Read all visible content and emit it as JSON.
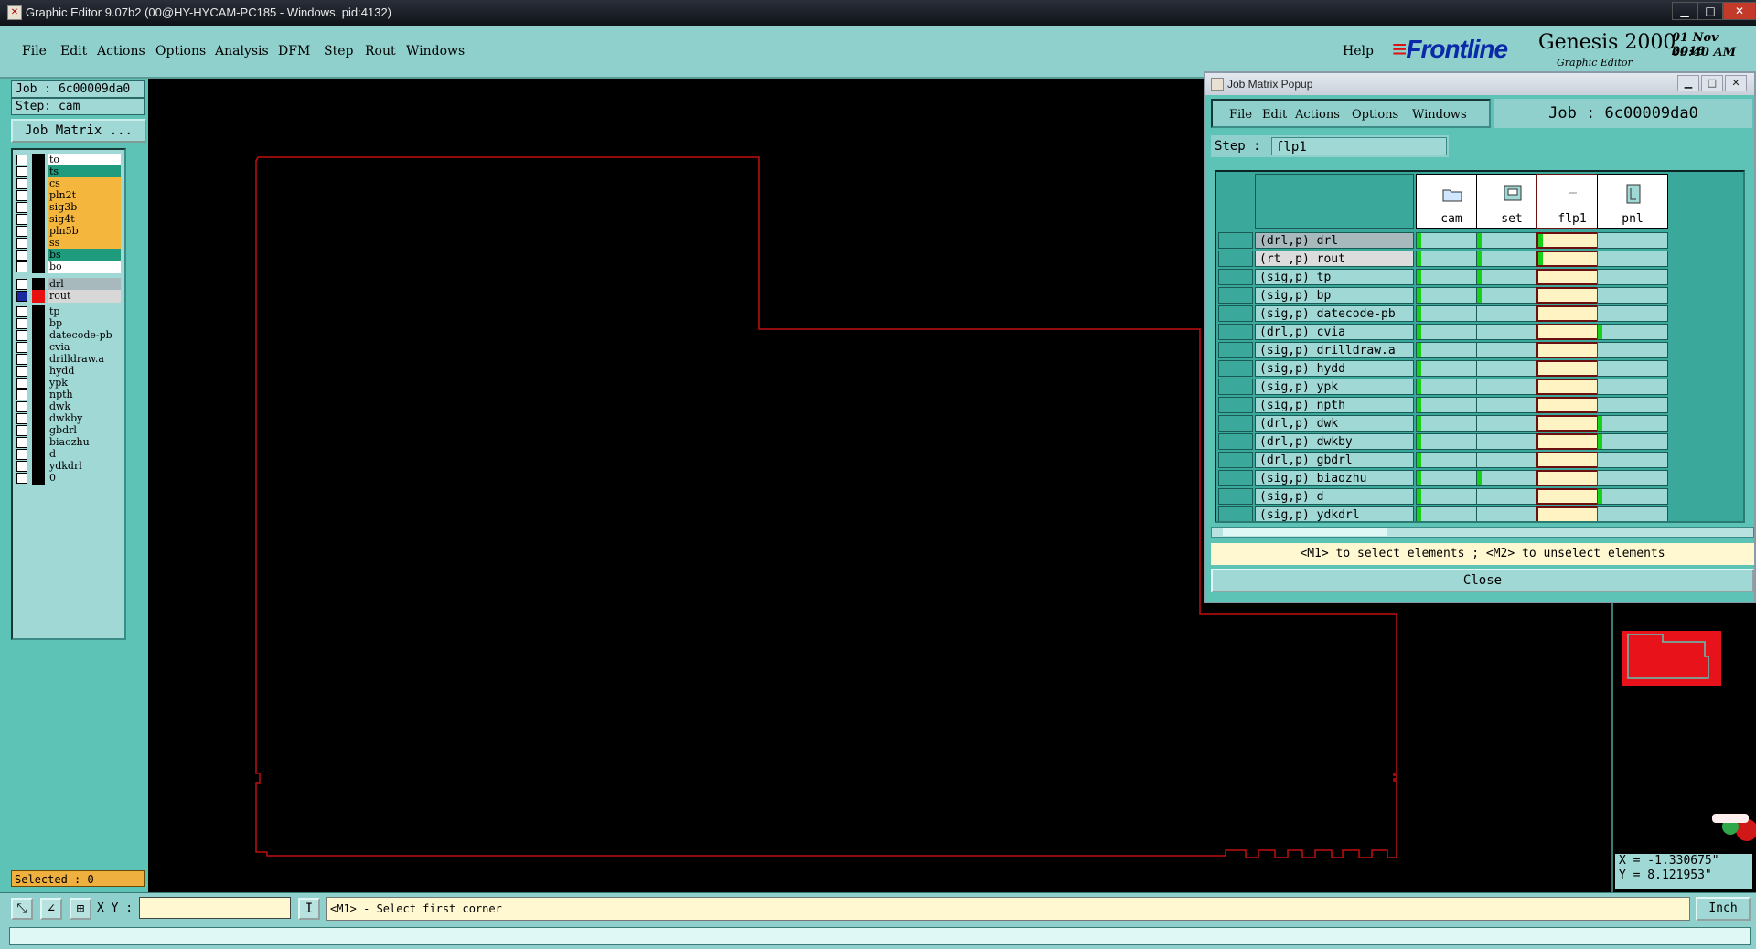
{
  "window": {
    "title": "Graphic Editor 9.07b2 (00@HY-HYCAM-PC185 - Windows, pid:4132)",
    "min": "▁",
    "max": "□",
    "close": "✕"
  },
  "menu": [
    "File",
    "Edit",
    "Actions",
    "Options",
    "Analysis",
    "DFM",
    "Step",
    "Rout",
    "Windows"
  ],
  "help": "Help",
  "brand": {
    "logo": "Frontline",
    "product": "Genesis 2000",
    "subtitle": "Graphic Editor",
    "date": "01 Nov 2018",
    "time": "09:40 AM"
  },
  "left": {
    "job": "Job : 6c00009da0",
    "step": "Step: cam",
    "job_matrix_btn": "Job Matrix ...",
    "selected": "Selected : 0",
    "board_layers": [
      {
        "name": "to",
        "color": "#ffffff"
      },
      {
        "name": "ts",
        "color": "#1f9b7e"
      },
      {
        "name": "cs",
        "color": "#f5b63e"
      },
      {
        "name": "pln2t",
        "color": "#f5b63e"
      },
      {
        "name": "sig3b",
        "color": "#f5b63e"
      },
      {
        "name": "sig4t",
        "color": "#f5b63e"
      },
      {
        "name": "pln5b",
        "color": "#f5b63e"
      },
      {
        "name": "ss",
        "color": "#f5b63e"
      },
      {
        "name": "bs",
        "color": "#1f9b7e"
      },
      {
        "name": "bo",
        "color": "#ffffff"
      }
    ],
    "drill_layers": [
      {
        "name": "drl",
        "color": "#a7b9bc"
      },
      {
        "name": "rout",
        "color": "#d8d8d8"
      }
    ],
    "misc_layers": [
      "tp",
      "bp",
      "datecode-pb",
      "cvia",
      "drilldraw.a",
      "hydd",
      "ypk",
      "npth",
      "dwk",
      "dwkby",
      "gbdrl",
      "biaozhu",
      "d",
      "ydkdrl",
      "0"
    ]
  },
  "bottom": {
    "xy_label": "X Y :",
    "prompt": "<M1> - Select first corner",
    "units": "Inch"
  },
  "coords": {
    "x": "X = -1.330675\"",
    "y": "Y = 8.121953\""
  },
  "popup": {
    "title": "Job Matrix Popup",
    "menu": [
      "File",
      "Edit",
      "Actions",
      "Options",
      "Windows"
    ],
    "job": "Job : 6c00009da0",
    "step_label": "Step :",
    "step_value": "flp1",
    "steps": [
      "cam",
      "set",
      "flp1",
      "pnl"
    ],
    "rows": [
      "(drl,p) drl",
      "(rt ,p) rout",
      "(sig,p) tp",
      "(sig,p) bp",
      "(sig,p) datecode-pb",
      "(drl,p) cvia",
      "(sig,p) drilldraw.a",
      "(sig,p) hydd",
      "(sig,p) ypk",
      "(sig,p) npth",
      "(drl,p) dwk",
      "(drl,p) dwkby",
      "(drl,p) gbdrl",
      "(sig,p) biaozhu",
      "(sig,p) d",
      "(sig,p) ydkdrl"
    ],
    "hint": "<M1> to select elements ; <M2> to unselect elements",
    "close": "Close"
  },
  "colors": {
    "panel": "#5ec3b7",
    "menu": "#8fd0cc",
    "field": "#9fd8d5",
    "outline": "#c01010",
    "canvas": "#000000"
  }
}
